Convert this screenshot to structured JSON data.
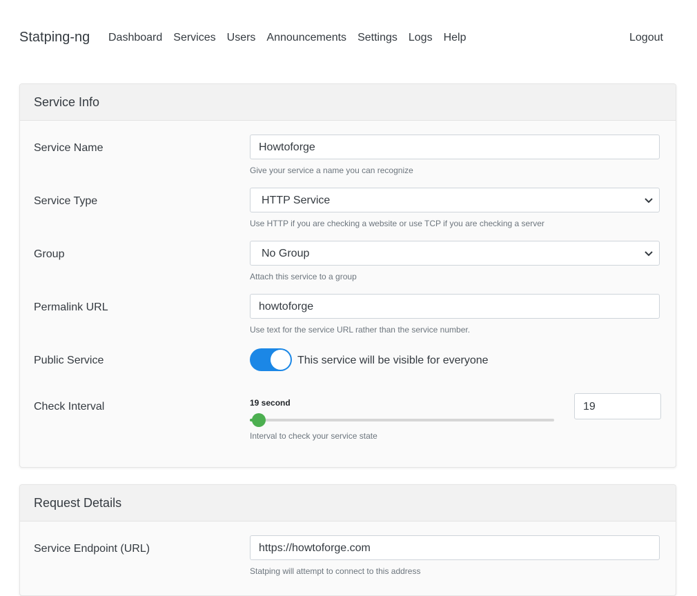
{
  "nav": {
    "brand": "Statping-ng",
    "links": [
      "Dashboard",
      "Services",
      "Users",
      "Announcements",
      "Settings",
      "Logs",
      "Help"
    ],
    "logout": "Logout"
  },
  "service_info": {
    "title": "Service Info",
    "service_name": {
      "label": "Service Name",
      "value": "Howtoforge",
      "help": "Give your service a name you can recognize"
    },
    "service_type": {
      "label": "Service Type",
      "value": "HTTP Service",
      "help": "Use HTTP if you are checking a website or use TCP if you are checking a server"
    },
    "group": {
      "label": "Group",
      "value": "No Group",
      "help": "Attach this service to a group"
    },
    "permalink": {
      "label": "Permalink URL",
      "value": "howtoforge",
      "help": "Use text for the service URL rather than the service number."
    },
    "public_service": {
      "label": "Public Service",
      "enabled": true,
      "text": "This service will be visible for everyone"
    },
    "check_interval": {
      "label": "Check Interval",
      "slider_label": "19 second",
      "value": "19",
      "slider_fraction": 0.03,
      "help": "Interval to check your service state"
    }
  },
  "request_details": {
    "title": "Request Details",
    "endpoint": {
      "label": "Service Endpoint (URL)",
      "value": "https://howtoforge.com",
      "help": "Statping will attempt to connect to this address"
    }
  },
  "colors": {
    "toggle_on": "#1b87e6",
    "slider": "#4caf50"
  }
}
